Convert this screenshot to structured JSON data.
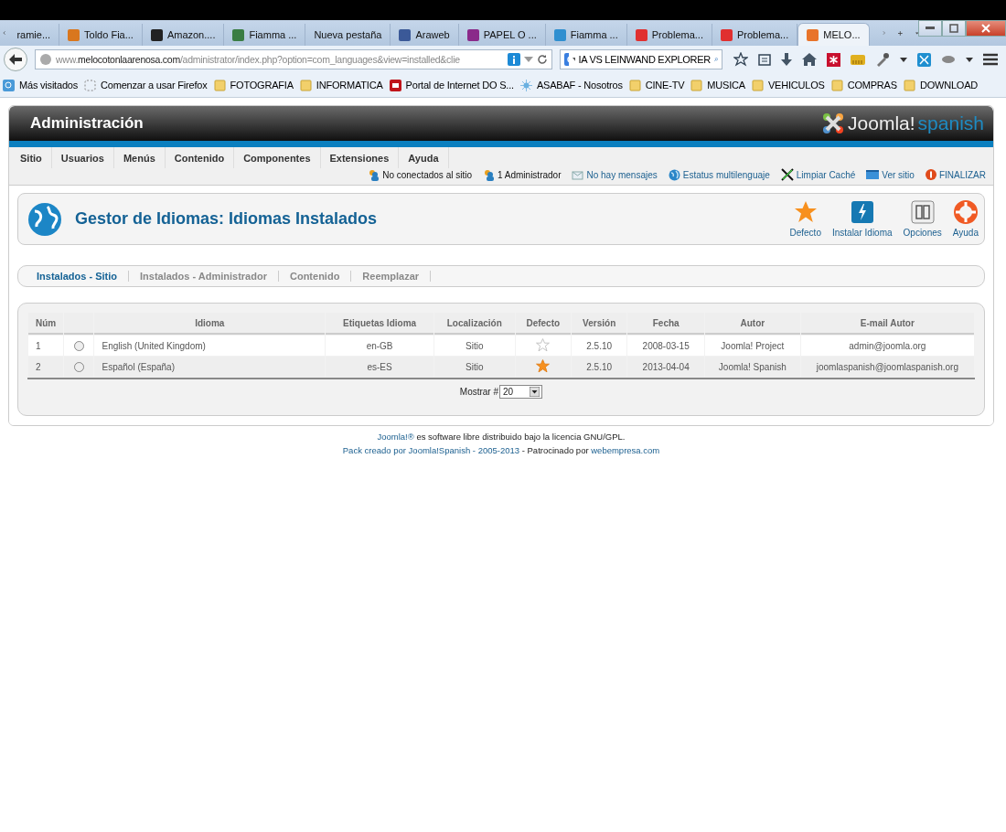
{
  "browser": {
    "tabs": [
      {
        "label": "ramie...",
        "selected": false
      },
      {
        "label": "Toldo Fia...",
        "selected": false,
        "color": "#d9771e"
      },
      {
        "label": "Amazon....",
        "selected": false,
        "color": "#222222"
      },
      {
        "label": "Fiamma ...",
        "selected": false,
        "color": "#3a7d44"
      },
      {
        "label": "Nueva pestaña",
        "selected": false
      },
      {
        "label": "Araweb",
        "selected": false,
        "color": "#3b5998"
      },
      {
        "label": "PAPEL O ...",
        "selected": false,
        "color": "#8a2a8a"
      },
      {
        "label": "Fiamma ...",
        "selected": false,
        "color": "#2f8fd0"
      },
      {
        "label": "Problema...",
        "selected": false,
        "color": "#e03030"
      },
      {
        "label": "Problema...",
        "selected": false,
        "color": "#e03030"
      },
      {
        "label": "MELO...",
        "selected": true,
        "color": "#e8742a"
      }
    ],
    "url": {
      "prefix": "www.",
      "domain": "melocotonlaarenosa.com",
      "path": "/administrator/index.php?option=com_languages&view=installed&clie"
    },
    "search": {
      "value": "IA VS LEINWAND EXPLORER"
    },
    "bookmarks": [
      {
        "label": "Más visitados",
        "kind": "special"
      },
      {
        "label": "Comenzar a usar Firefox",
        "kind": "dashed"
      },
      {
        "label": "FOTOGRAFIA",
        "kind": "folder"
      },
      {
        "label": "INFORMATICA",
        "kind": "folder"
      },
      {
        "label": "Portal de Internet DO S...",
        "kind": "site"
      },
      {
        "label": "ASABAF - Nosotros",
        "kind": "sun"
      },
      {
        "label": "CINE-TV",
        "kind": "folder"
      },
      {
        "label": "MUSICA",
        "kind": "folder"
      },
      {
        "label": "VEHICULOS",
        "kind": "folder"
      },
      {
        "label": "COMPRAS",
        "kind": "folder"
      },
      {
        "label": "DOWNLOAD",
        "kind": "folder"
      }
    ]
  },
  "header": {
    "title": "Administración",
    "logo": {
      "brand": "Joomla!",
      "sub": "spanish"
    }
  },
  "menu": [
    "Sitio",
    "Usuarios",
    "Menús",
    "Contenido",
    "Componentes",
    "Extensiones",
    "Ayuda"
  ],
  "status": [
    {
      "label": "No conectados al sitio",
      "kind": "users",
      "link": false
    },
    {
      "label": "1 Administrador",
      "kind": "users",
      "link": false
    },
    {
      "label": "No hay mensajes",
      "kind": "mail",
      "link": true
    },
    {
      "label": "Estatus multilenguaje",
      "kind": "globe",
      "link": true
    },
    {
      "label": "Limpiar Caché",
      "kind": "bolt",
      "link": true
    },
    {
      "label": "Ver sitio",
      "kind": "screen",
      "link": true
    },
    {
      "label": "FINALIZAR",
      "kind": "exit",
      "link": true
    }
  ],
  "page_title": "Gestor de Idiomas: Idiomas Instalados",
  "toolbar": [
    {
      "label": "Defecto",
      "kind": "star"
    },
    {
      "label": "Instalar Idioma",
      "kind": "install"
    },
    {
      "label": "Opciones",
      "kind": "options"
    },
    {
      "label": "Ayuda",
      "kind": "help"
    }
  ],
  "subtabs": [
    {
      "label": "Instalados - Sitio",
      "selected": true
    },
    {
      "label": "Instalados - Administrador",
      "selected": false
    },
    {
      "label": "Contenido",
      "selected": false
    },
    {
      "label": "Reemplazar",
      "selected": false
    }
  ],
  "table": {
    "columns": [
      "Núm",
      "Idioma",
      "Etiquetas Idioma",
      "Localización",
      "Defecto",
      "Versión",
      "Fecha",
      "Autor",
      "E-mail Autor"
    ],
    "rows": [
      {
        "num": "1",
        "checked": false,
        "language": "English (United Kingdom)",
        "tag": "en-GB",
        "location": "Sitio",
        "default": false,
        "version": "2.5.10",
        "date": "2008-03-15",
        "author": "Joomla! Project",
        "email": "admin@joomla.org"
      },
      {
        "num": "2",
        "checked": false,
        "language": "Español (España)",
        "tag": "es-ES",
        "location": "Sitio",
        "default": true,
        "version": "2.5.10",
        "date": "2013-04-04",
        "author": "Joomla! Spanish",
        "email": "joomlaspanish@joomlaspanish.org"
      }
    ]
  },
  "pagination": {
    "label": "Mostrar #",
    "value": "20"
  },
  "footer": {
    "line1": {
      "link": "Joomla!®",
      "text": " es software libre distribuido bajo la licencia GNU/GPL."
    },
    "line2": {
      "link": "Pack creado por Joomla!Spanish - 2005-2013",
      "text": " - Patrocinado por ",
      "link2": "webempresa.com"
    }
  }
}
